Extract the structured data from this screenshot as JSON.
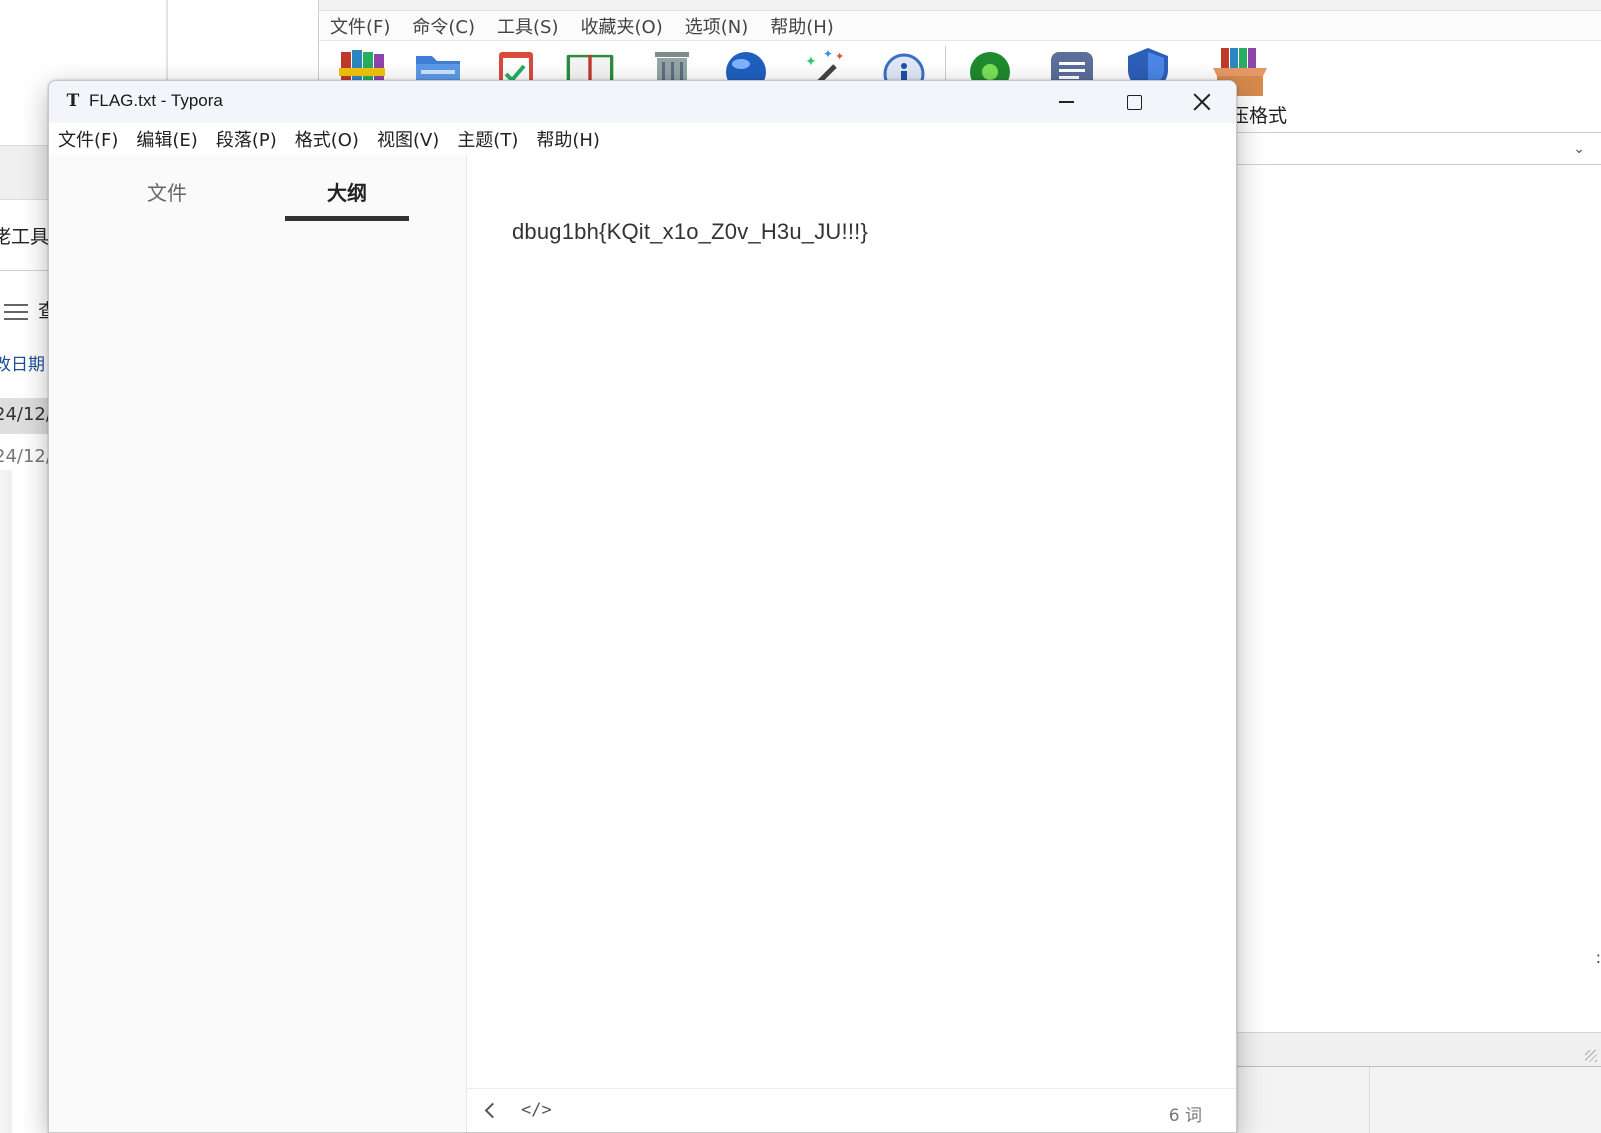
{
  "background_explorer": {
    "partial_title": "佬工具",
    "partial_view_label": "查",
    "column_header_partial": "改日期",
    "row_dates": [
      "24/12/",
      "24/12/"
    ]
  },
  "background_archiver": {
    "menu": [
      "文件(F)",
      "命令(C)",
      "工具(S)",
      "收藏夹(O)",
      "选项(N)",
      "帮助(H)"
    ],
    "toolbar_visible_label": "解压格式"
  },
  "typora": {
    "title": "FLAG.txt - Typora",
    "menu": [
      "文件(F)",
      "编辑(E)",
      "段落(P)",
      "格式(O)",
      "视图(V)",
      "主题(T)",
      "帮助(H)"
    ],
    "sidebar": {
      "tab_files": "文件",
      "tab_outline": "大纲",
      "active_tab": "大纲"
    },
    "document": {
      "content": "dbug1bh{KQit_x1o_Z0v_H3u_JU!!!}"
    },
    "statusbar": {
      "source_code_icon": "</>",
      "word_count": "6 词"
    }
  }
}
